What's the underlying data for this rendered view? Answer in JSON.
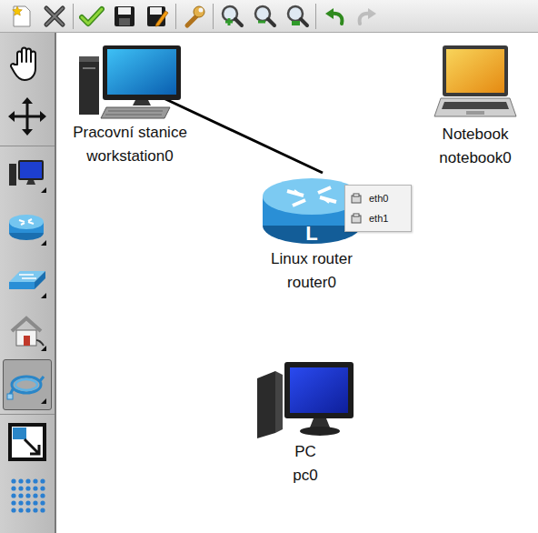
{
  "toolbar": {
    "groups": [
      [
        {
          "kind": "new",
          "disabled": false
        },
        {
          "kind": "delete",
          "disabled": false
        }
      ],
      [
        {
          "kind": "check",
          "disabled": false
        },
        {
          "kind": "save",
          "disabled": false
        },
        {
          "kind": "save-as",
          "disabled": false
        }
      ],
      [
        {
          "kind": "settings",
          "disabled": false
        }
      ],
      [
        {
          "kind": "zoom-in",
          "disabled": false
        },
        {
          "kind": "zoom-out",
          "disabled": false
        },
        {
          "kind": "zoom-reset",
          "disabled": false
        }
      ],
      [
        {
          "kind": "undo",
          "disabled": false
        },
        {
          "kind": "redo",
          "disabled": true
        }
      ]
    ]
  },
  "tools": {
    "groups": [
      [
        {
          "kind": "hand",
          "selected": false
        },
        {
          "kind": "move",
          "selected": false
        }
      ],
      [
        {
          "kind": "computer",
          "selected": false
        },
        {
          "kind": "router",
          "selected": false
        },
        {
          "kind": "switch",
          "selected": false
        },
        {
          "kind": "house",
          "selected": false
        },
        {
          "kind": "cable",
          "selected": true
        }
      ],
      [
        {
          "kind": "fit",
          "selected": false
        },
        {
          "kind": "grid",
          "selected": false
        }
      ]
    ]
  },
  "nodes": [
    {
      "kind": "workstation",
      "label": "Pracovní stanice",
      "name": "workstation0"
    },
    {
      "kind": "notebook",
      "label": "Notebook",
      "name": "notebook0"
    },
    {
      "kind": "router",
      "label": "Linux router",
      "name": "router0",
      "badge": "L"
    },
    {
      "kind": "pc",
      "label": "PC",
      "name": "pc0"
    }
  ],
  "links": [
    {
      "from": "workstation0",
      "to": "router0"
    }
  ],
  "context_menu": {
    "items": [
      {
        "label": "eth0"
      },
      {
        "label": "eth1"
      }
    ]
  }
}
